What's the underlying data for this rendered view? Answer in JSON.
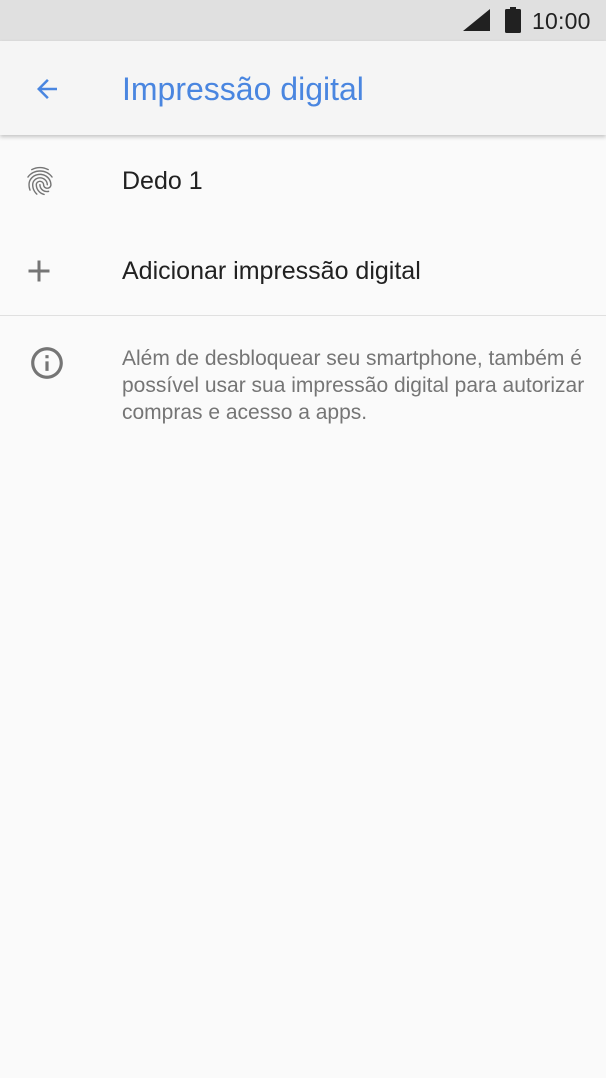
{
  "status_bar": {
    "time": "10:00",
    "signal_icon": "signal-icon",
    "battery_icon": "battery-icon"
  },
  "app_bar": {
    "back_icon": "arrow-back-icon",
    "title": "Impressão digital",
    "accent_color": "#4a86e0"
  },
  "list": {
    "items": [
      {
        "icon": "fingerprint-icon",
        "label": "Dedo 1"
      },
      {
        "icon": "plus-icon",
        "label": "Adicionar impressão digital"
      }
    ]
  },
  "info": {
    "icon": "info-icon",
    "text": "Além de desbloquear seu smartphone, também é possível usar sua impressão digital para autorizar compras e acesso a apps."
  }
}
